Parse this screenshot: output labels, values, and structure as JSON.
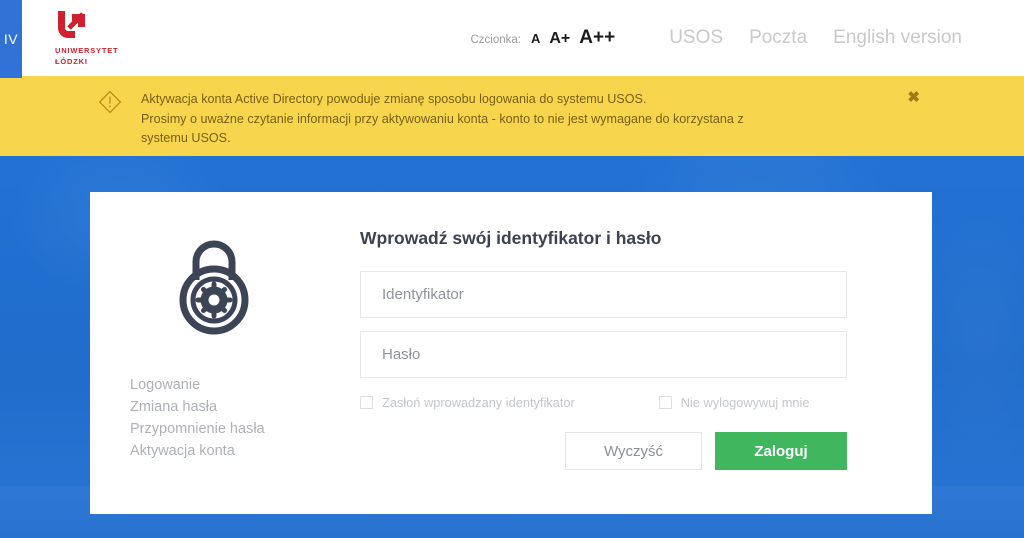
{
  "window": {
    "tab_label": "IV"
  },
  "header": {
    "logo": {
      "icon": "uni-lodz-logo-icon",
      "line1": "UNIWERSYTET",
      "line2": "ŁÓDZKI"
    },
    "font_size": {
      "label": "Czcionka:",
      "options": [
        "A",
        "A+",
        "A++"
      ]
    },
    "links": [
      "USOS",
      "Poczta",
      "English version"
    ]
  },
  "alert": {
    "icon": "warning-diamond-icon",
    "line1": "Aktywacja konta Active Directory powoduje zmianę sposobu logowania do systemu USOS.",
    "line2": "Prosimy o uważne czytanie informacji przy aktywowaniu konta - konto to nie jest wymagane do korzystana z",
    "line3": "systemu USOS.",
    "close_label": "✖",
    "background_color": "#f7d64e",
    "text_color": "#7a5e12"
  },
  "card": {
    "lock_icon": "padlock-gear-icon",
    "side_links": [
      "Logowanie",
      "Zmiana hasła",
      "Przypomnienie hasła",
      "Aktywacja konta"
    ],
    "form": {
      "title": "Wprowadź swój identyfikator i hasło",
      "identifier": {
        "value": "",
        "placeholder": "Identyfikator"
      },
      "password": {
        "value": "",
        "placeholder": "Hasło"
      },
      "checkboxes": [
        {
          "label": "Zasłoń wprowadzany identyfikator",
          "checked": false
        },
        {
          "label": "Nie wylogowywuj mnie",
          "checked": false
        }
      ],
      "buttons": {
        "clear": "Wyczyść",
        "submit": "Zaloguj"
      }
    }
  },
  "colors": {
    "page_background": "#1f6fd0",
    "accent_green": "#40b75f",
    "brand_red": "#cf2030",
    "alert_yellow": "#f7d64e",
    "dark_slate": "#3b4252"
  }
}
